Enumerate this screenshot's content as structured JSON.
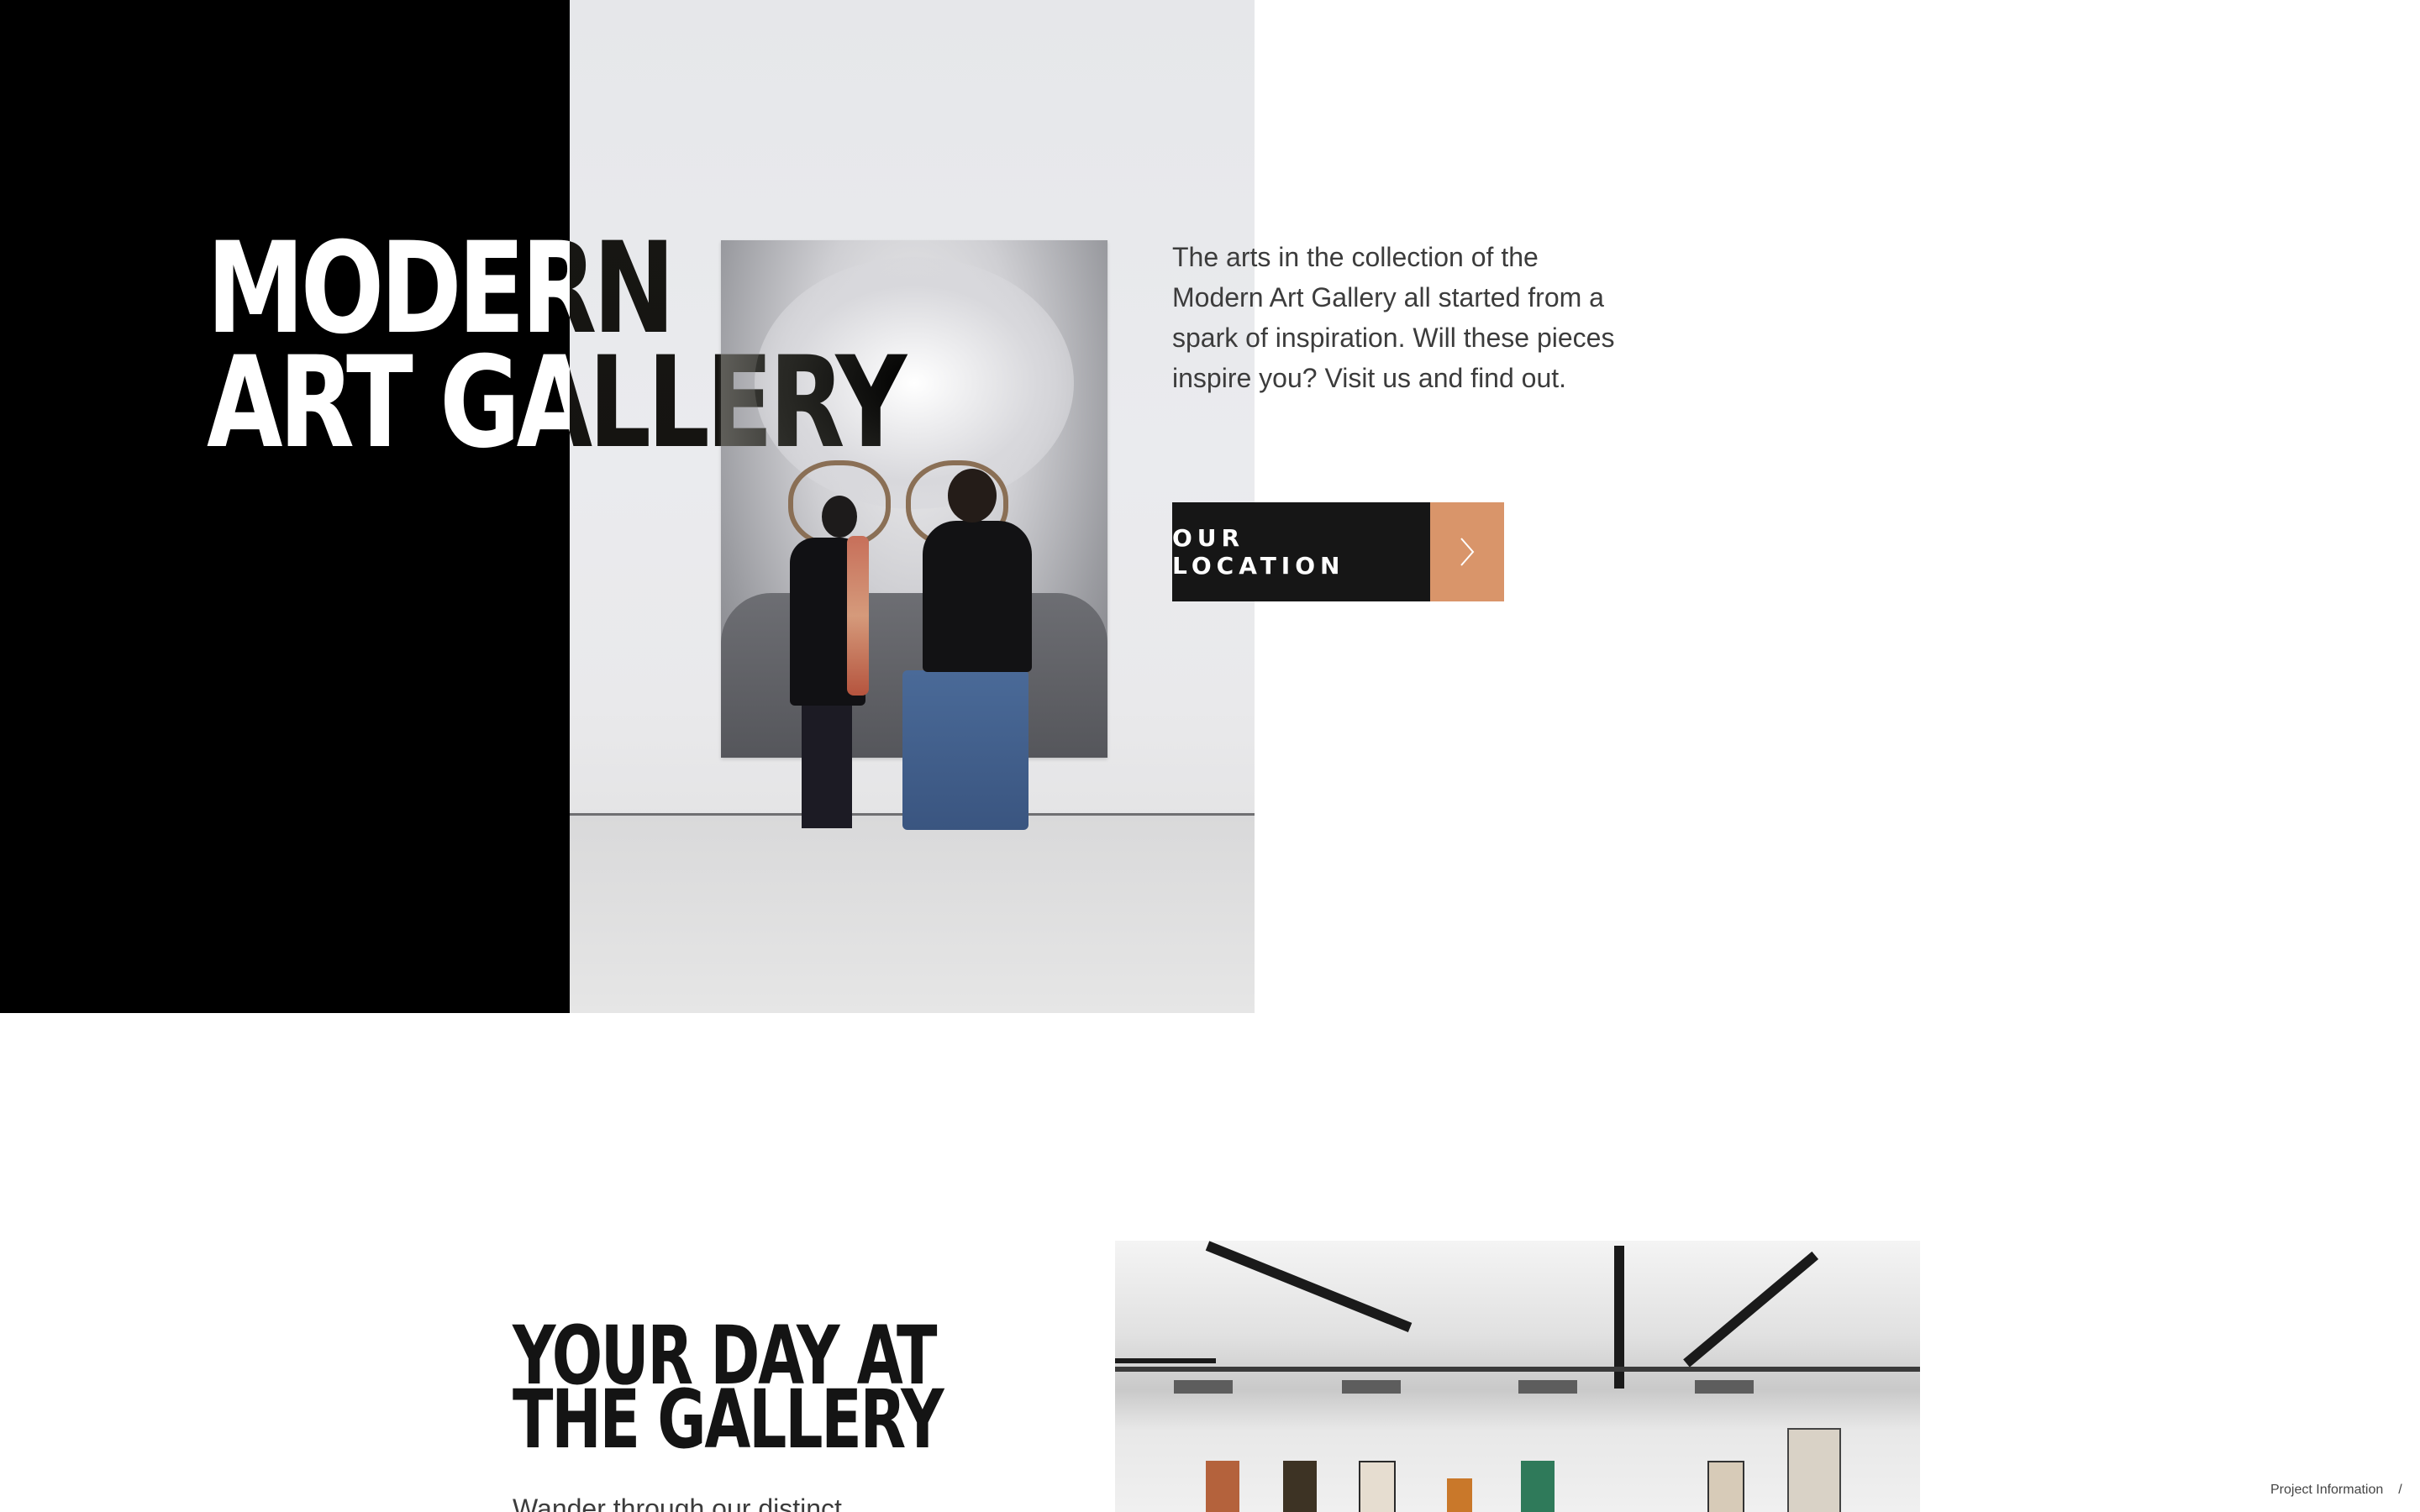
{
  "hero": {
    "title_line1": "MODERN",
    "title_line2": "ART GALLERY",
    "description": "The arts in the collection of the Modern Art Gallery all started from a spark of inspiration. Will these pieces inspire you? Visit us and find out.",
    "cta_label": "OUR LOCATION",
    "cta_icon": "chevron-right-icon",
    "photo": "two-visitors-viewing-portrait-painting"
  },
  "section2": {
    "title_line1": "YOUR DAY AT",
    "title_line2": "THE GALLERY",
    "text": "Wander through our distinct",
    "photo": "gallery-exhibition-hall"
  },
  "project_info": {
    "label": "Project Information",
    "icon": "slash-icon",
    "icon_glyph": "/"
  },
  "colors": {
    "black_panel": "#000000",
    "dark_button": "#161616",
    "accent": "#d9956a",
    "text": "#3c3c3c",
    "background": "#ffffff"
  }
}
